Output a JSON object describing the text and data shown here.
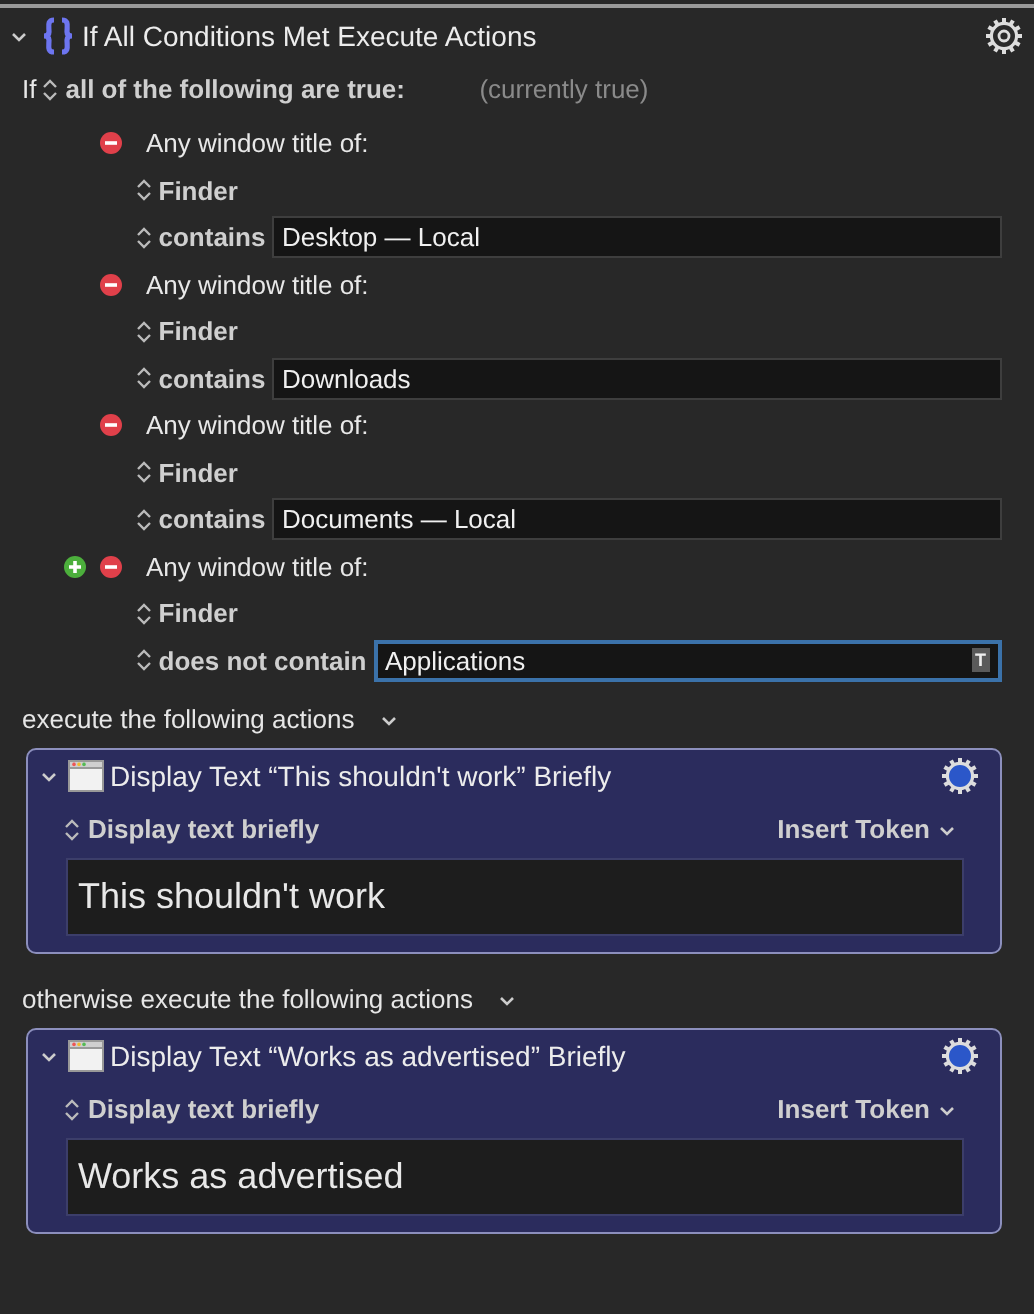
{
  "header": {
    "title": "If All Conditions Met Execute Actions",
    "expanded": true
  },
  "if_row": {
    "prefix": "If",
    "mode": "all of the following are true:",
    "status": "(currently true)"
  },
  "conditions": [
    {
      "show_add": false,
      "label": "Any window title of:",
      "app": "Finder",
      "operator": "contains",
      "value": "Desktop — Local",
      "focused": false
    },
    {
      "show_add": false,
      "label": "Any window title of:",
      "app": "Finder",
      "operator": "contains",
      "value": "Downloads",
      "focused": false
    },
    {
      "show_add": false,
      "label": "Any window title of:",
      "app": "Finder",
      "operator": "contains",
      "value": "Documents — Local",
      "focused": false
    },
    {
      "show_add": true,
      "label": "Any window title of:",
      "app": "Finder",
      "operator": "does not contain",
      "value": "Applications",
      "focused": true,
      "token_button": "T"
    }
  ],
  "branches": [
    {
      "label": "execute the following actions",
      "action": {
        "title": "Display Text “This shouldn't work” Briefly",
        "expanded": true,
        "mode": "Display text briefly",
        "token_menu": "Insert Token",
        "text": "This shouldn't work"
      }
    },
    {
      "label": "otherwise execute the following actions",
      "action": {
        "title": "Display Text “Works as advertised” Briefly",
        "expanded": true,
        "mode": "Display text briefly",
        "token_menu": "Insert Token",
        "text": "Works as advertised"
      }
    }
  ]
}
